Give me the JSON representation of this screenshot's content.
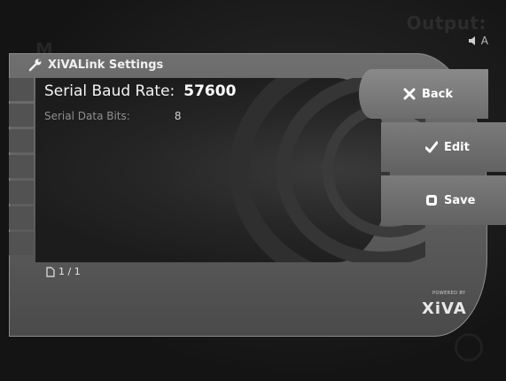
{
  "header": {
    "output_label": "Output:",
    "audio_label": "A",
    "bg_letter": "M"
  },
  "window": {
    "title": "XiVALink Settings"
  },
  "settings": {
    "items": [
      {
        "label": "Serial Baud Rate:",
        "value": "57600"
      },
      {
        "label": "Serial Data Bits:",
        "value": "8"
      }
    ]
  },
  "buttons": {
    "back": "Back",
    "edit": "Edit",
    "save": "Save"
  },
  "footer": {
    "page_indicator": "1 / 1",
    "powered_by": "POWERED BY",
    "brand": "XiVA"
  },
  "colors": {
    "panel": "#6f6f6f",
    "content_bg": "#1c1c1c",
    "text": "#ffffff",
    "muted": "#8f8f8f"
  },
  "icons": [
    "wrench-icon",
    "speaker-icon",
    "close-icon",
    "checkmark-icon",
    "save-icon",
    "document-icon"
  ]
}
